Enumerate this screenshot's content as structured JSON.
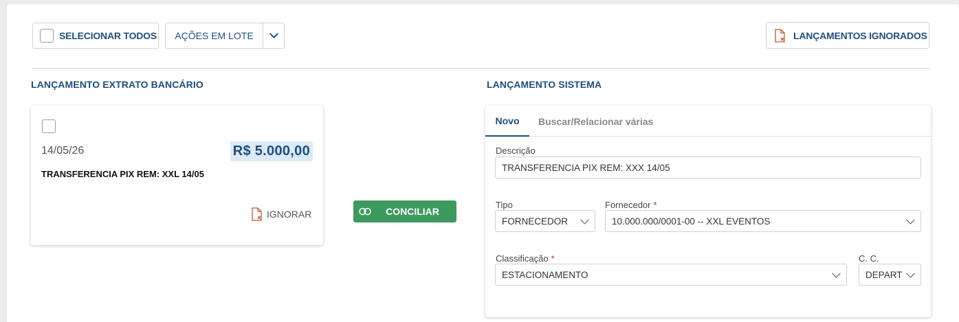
{
  "toolbar": {
    "select_all_label": "SELECIONAR TODOS",
    "batch_actions_label": "AÇÕES EM LOTE",
    "ignored_label": "LANÇAMENTOS IGNORADOS"
  },
  "bank_section": {
    "title": "LANÇAMENTO EXTRATO BANCÁRIO",
    "entry": {
      "date": "14/05/26",
      "amount": "R$ 5.000,00",
      "description": "TRANSFERENCIA PIX REM: XXL 14/05",
      "ignore_label": "IGNORAR"
    }
  },
  "reconcile_label": "CONCILIAR",
  "system_section": {
    "title": "LANÇAMENTO SISTEMA",
    "tabs": [
      {
        "label": "Novo",
        "active": true
      },
      {
        "label": "Buscar/Relacionar várias",
        "active": false
      }
    ],
    "form": {
      "descricao_label": "Descrição",
      "descricao_value": "TRANSFERENCIA PIX REM: XXX 14/05",
      "tipo_label": "Tipo",
      "tipo_value": "FORNECEDOR",
      "fornecedor_label": "Fornecedor",
      "fornecedor_value": "10.000.000/0001-00 -- XXL EVENTOS",
      "classificacao_label": "Classificação",
      "classificacao_value": "ESTACIONAMENTO",
      "cc_label": "C. C.",
      "cc_value": "DEPART",
      "required_mark": "*"
    }
  },
  "colors": {
    "primary_text": "#1d4f7c",
    "success": "#3c9a5f",
    "amount_bg": "#dbeaf6",
    "required": "#c62828",
    "ignore_icon": "#c0563a"
  }
}
